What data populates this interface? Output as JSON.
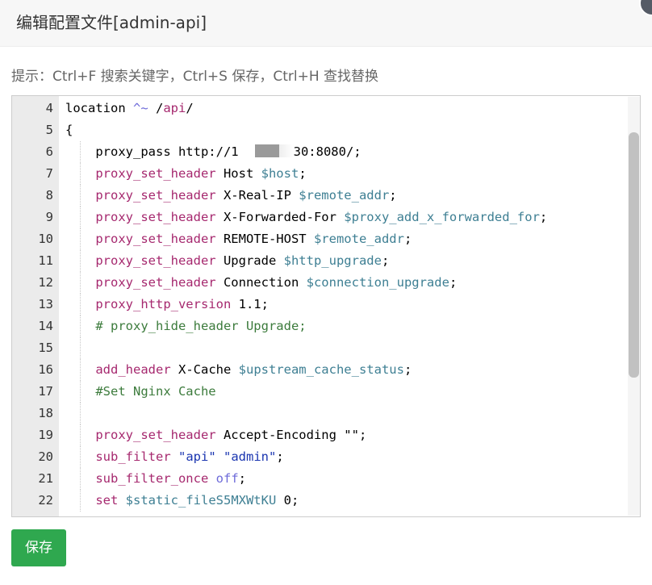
{
  "dialog": {
    "title": "编辑配置文件[admin-api]",
    "hint": "提示：Ctrl+F 搜索关键字，Ctrl+S 保存，Ctrl+H 查找替换",
    "save_label": "保存"
  },
  "editor": {
    "lines": [
      {
        "num": "4",
        "tokens": [
          {
            "t": "location ",
            "c": ""
          },
          {
            "t": "^~",
            "c": "op"
          },
          {
            "t": " /",
            "c": ""
          },
          {
            "t": "api",
            "c": "kw"
          },
          {
            "t": "/",
            "c": ""
          }
        ]
      },
      {
        "num": "5",
        "tokens": [
          {
            "t": "{",
            "c": ""
          }
        ]
      },
      {
        "num": "6",
        "tokens": [
          {
            "t": "    proxy_pass http://1",
            "c": ""
          },
          {
            "t": "MASK",
            "c": "mask"
          },
          {
            "t": "30:8080/;",
            "c": ""
          }
        ]
      },
      {
        "num": "7",
        "tokens": [
          {
            "t": "    ",
            "c": ""
          },
          {
            "t": "proxy_set_header",
            "c": "kw"
          },
          {
            "t": " Host ",
            "c": ""
          },
          {
            "t": "$host",
            "c": "var"
          },
          {
            "t": ";",
            "c": ""
          }
        ]
      },
      {
        "num": "8",
        "tokens": [
          {
            "t": "    ",
            "c": ""
          },
          {
            "t": "proxy_set_header",
            "c": "kw"
          },
          {
            "t": " X-Real-IP ",
            "c": ""
          },
          {
            "t": "$remote_addr",
            "c": "var"
          },
          {
            "t": ";",
            "c": ""
          }
        ]
      },
      {
        "num": "9",
        "tokens": [
          {
            "t": "    ",
            "c": ""
          },
          {
            "t": "proxy_set_header",
            "c": "kw"
          },
          {
            "t": " X-Forwarded-For ",
            "c": ""
          },
          {
            "t": "$proxy_add_x_forwarded_for",
            "c": "var"
          },
          {
            "t": ";",
            "c": ""
          }
        ]
      },
      {
        "num": "10",
        "tokens": [
          {
            "t": "    ",
            "c": ""
          },
          {
            "t": "proxy_set_header",
            "c": "kw"
          },
          {
            "t": " REMOTE-HOST ",
            "c": ""
          },
          {
            "t": "$remote_addr",
            "c": "var"
          },
          {
            "t": ";",
            "c": ""
          }
        ]
      },
      {
        "num": "11",
        "tokens": [
          {
            "t": "    ",
            "c": ""
          },
          {
            "t": "proxy_set_header",
            "c": "kw"
          },
          {
            "t": " Upgrade ",
            "c": ""
          },
          {
            "t": "$http_upgrade",
            "c": "var"
          },
          {
            "t": ";",
            "c": ""
          }
        ]
      },
      {
        "num": "12",
        "tokens": [
          {
            "t": "    ",
            "c": ""
          },
          {
            "t": "proxy_set_header",
            "c": "kw"
          },
          {
            "t": " Connection ",
            "c": ""
          },
          {
            "t": "$connection_upgrade",
            "c": "var"
          },
          {
            "t": ";",
            "c": ""
          }
        ]
      },
      {
        "num": "13",
        "tokens": [
          {
            "t": "    ",
            "c": ""
          },
          {
            "t": "proxy_http_version",
            "c": "kw"
          },
          {
            "t": " 1.1;",
            "c": ""
          }
        ]
      },
      {
        "num": "14",
        "tokens": [
          {
            "t": "    ",
            "c": ""
          },
          {
            "t": "# proxy_hide_header Upgrade;",
            "c": "cmt"
          }
        ]
      },
      {
        "num": "15",
        "tokens": []
      },
      {
        "num": "16",
        "tokens": [
          {
            "t": "    ",
            "c": ""
          },
          {
            "t": "add_header",
            "c": "kw"
          },
          {
            "t": " X-Cache ",
            "c": ""
          },
          {
            "t": "$upstream_cache_status",
            "c": "var"
          },
          {
            "t": ";",
            "c": ""
          }
        ]
      },
      {
        "num": "17",
        "tokens": [
          {
            "t": "    ",
            "c": ""
          },
          {
            "t": "#Set Nginx Cache",
            "c": "cmt"
          }
        ]
      },
      {
        "num": "18",
        "tokens": []
      },
      {
        "num": "19",
        "tokens": [
          {
            "t": "    ",
            "c": ""
          },
          {
            "t": "proxy_set_header",
            "c": "kw"
          },
          {
            "t": " Accept-Encoding ",
            "c": ""
          },
          {
            "t": "\"\"",
            "c": ""
          },
          {
            "t": ";",
            "c": ""
          }
        ]
      },
      {
        "num": "20",
        "tokens": [
          {
            "t": "    ",
            "c": ""
          },
          {
            "t": "sub_filter",
            "c": "kw"
          },
          {
            "t": " ",
            "c": ""
          },
          {
            "t": "\"api\"",
            "c": "str"
          },
          {
            "t": " ",
            "c": ""
          },
          {
            "t": "\"admin\"",
            "c": "str"
          },
          {
            "t": ";",
            "c": ""
          }
        ]
      },
      {
        "num": "21",
        "tokens": [
          {
            "t": "    ",
            "c": ""
          },
          {
            "t": "sub_filter_once",
            "c": "kw"
          },
          {
            "t": " ",
            "c": ""
          },
          {
            "t": "off",
            "c": "op"
          },
          {
            "t": ";",
            "c": ""
          }
        ]
      },
      {
        "num": "22",
        "tokens": [
          {
            "t": "    ",
            "c": ""
          },
          {
            "t": "set",
            "c": "kw"
          },
          {
            "t": " ",
            "c": ""
          },
          {
            "t": "$static_fileS5MXWtKU",
            "c": "var"
          },
          {
            "t": " 0;",
            "c": ""
          }
        ]
      }
    ]
  },
  "colors": {
    "save_button": "#2fa84f",
    "keyword": "#a6296f",
    "variable": "#3e7f93",
    "comment": "#3c7b3c",
    "string": "#1a35b0",
    "gutter": "#ebebeb"
  }
}
